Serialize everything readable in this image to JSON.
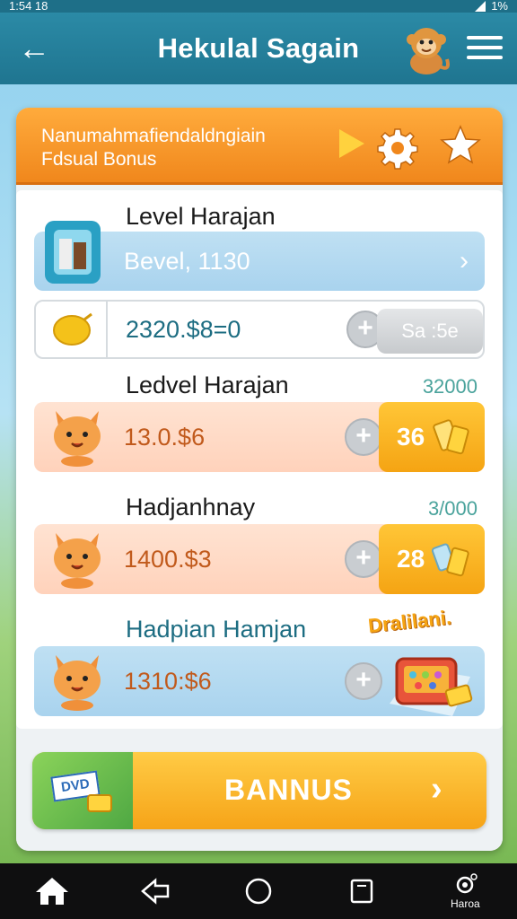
{
  "status": {
    "time": "1:54 18",
    "battery": "1%"
  },
  "app": {
    "title": "Hekulal Sagain",
    "back": "←"
  },
  "banner": {
    "line1": "Nanumahmafiendaldngiain",
    "line2": "Fdsual Bonus"
  },
  "sections": [
    {
      "title": "Level Harajan",
      "rows": [
        {
          "text": "Bevel, 1130",
          "chevron": "›"
        },
        {
          "text": "2320.$8=0",
          "plus": "+",
          "button": "Sa :5e"
        }
      ]
    },
    {
      "title": "Ledvel Harajan",
      "value": "32000",
      "row": {
        "text": "13.0.$6",
        "plus": "+",
        "button": "36"
      }
    },
    {
      "title": "Hadjanhnay",
      "value": "3/000",
      "row": {
        "text": "1400.$3",
        "plus": "+",
        "button": "28"
      }
    },
    {
      "title": "Hadpian Hamjan",
      "badge": "Dralilani.",
      "row": {
        "text": "1310:$6",
        "plus": "+"
      }
    }
  ],
  "bonus": {
    "badge": "DVD",
    "label": "BANNUS",
    "chevron": "›"
  },
  "nav": {
    "profile_label": "Haroa"
  },
  "colors": {
    "accent_orange": "#f0871c",
    "gold": "#f5a413",
    "teal": "#1f7590"
  }
}
